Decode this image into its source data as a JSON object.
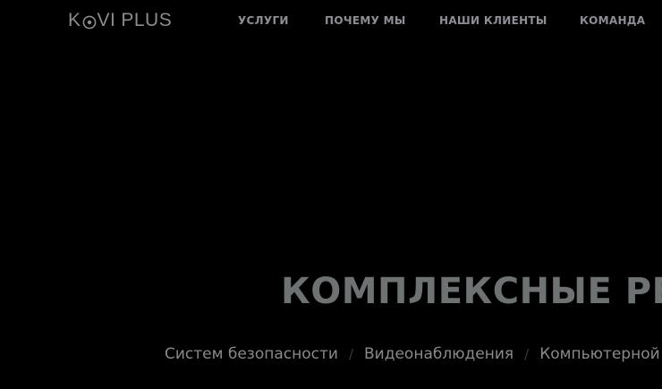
{
  "header": {
    "logo": {
      "letter_k": "K",
      "letters_vi": "VI",
      "word_plus": "PLUS",
      "icon": "eye-circle-icon",
      "color": "#8c8c8c"
    },
    "nav": {
      "services": "УСЛУГИ",
      "why_us": "ПОЧЕМУ МЫ",
      "clients": "НАШИ КЛИЕНТЫ",
      "team": "КОМАНДА"
    }
  },
  "hero": {
    "title": "КОМПЛЕКСНЫЕ РЕ",
    "subtitle": {
      "item1": "Систем безопасности",
      "sep1": "/",
      "item2": "Видеонаблюдения",
      "sep2": "/",
      "item3": "Компьютерной и"
    }
  },
  "colors": {
    "background": "#000000",
    "title": "#6f7273",
    "nav": "#8e8e96",
    "subtitle": "#8a8a8a",
    "separator": "#3c3c3c"
  }
}
